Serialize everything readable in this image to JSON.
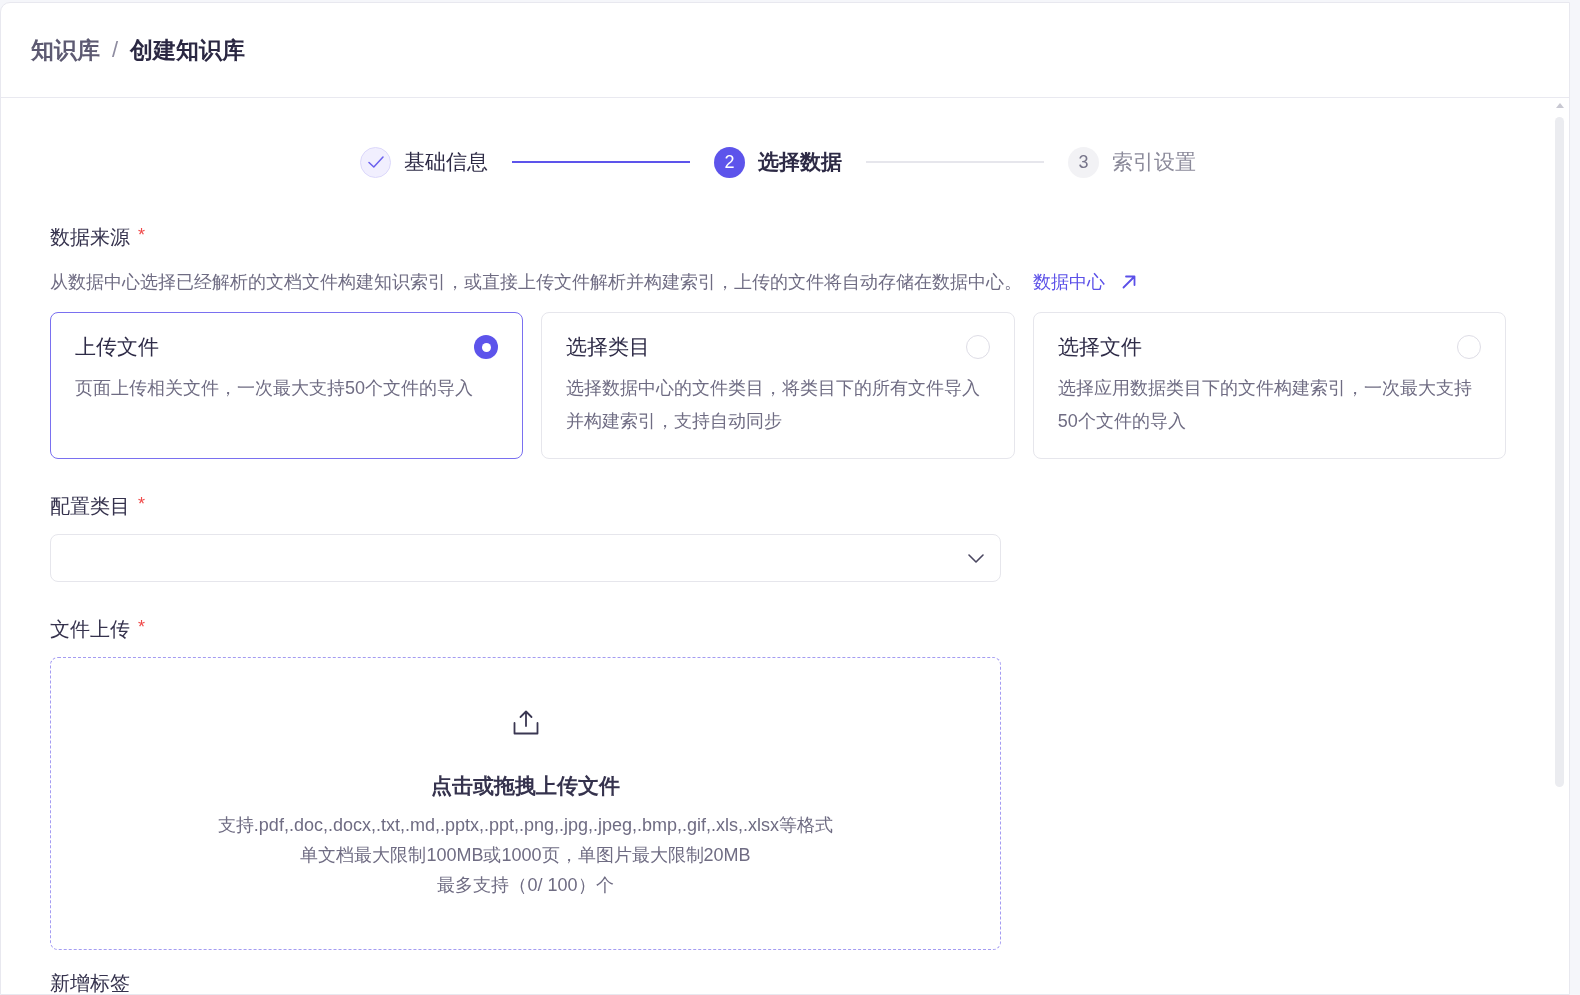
{
  "breadcrumb": {
    "items": [
      {
        "label": "知识库",
        "current": false
      },
      {
        "label": "创建知识库",
        "current": true
      }
    ],
    "separator": "/"
  },
  "steps": [
    {
      "label": "基础信息",
      "completed": true,
      "selected": false
    },
    {
      "label": "选择数据",
      "number": "2",
      "completed": false,
      "selected": true
    },
    {
      "label": "索引设置",
      "number": "3",
      "completed": false,
      "selected": false
    }
  ],
  "data_source": {
    "label": "数据来源",
    "required_mark": "*",
    "description": "从数据中心选择已经解析的文档文件构建知识索引，或直接上传文件解析并构建索引，上传的文件将自动存储在数据中心。",
    "link": {
      "label": "数据中心"
    },
    "options": [
      {
        "title": "上传文件",
        "description": "页面上传相关文件，一次最大支持50个文件的导入",
        "selected": true
      },
      {
        "title": "选择类目",
        "description": "选择数据中心的文件类目，将类目下的所有文件导入并构建索引，支持自动同步",
        "selected": false
      },
      {
        "title": "选择文件",
        "description": "选择应用数据类目下的文件构建索引，一次最大支持50个文件的导入",
        "selected": false
      }
    ]
  },
  "category": {
    "label": "配置类目",
    "required_mark": "*"
  },
  "file_upload": {
    "label": "文件上传",
    "required_mark": "*",
    "title": "点击或拖拽上传文件",
    "hints": [
      "支持.pdf,.doc,.docx,.txt,.md,.pptx,.ppt,.png,.jpg,.jpeg,.bmp,.gif,.xls,.xlsx等格式",
      "单文档最大限制100MB或1000页，单图片最大限制20MB",
      "最多支持（0/ 100）个"
    ]
  },
  "tags": {
    "label": "新增标签"
  }
}
